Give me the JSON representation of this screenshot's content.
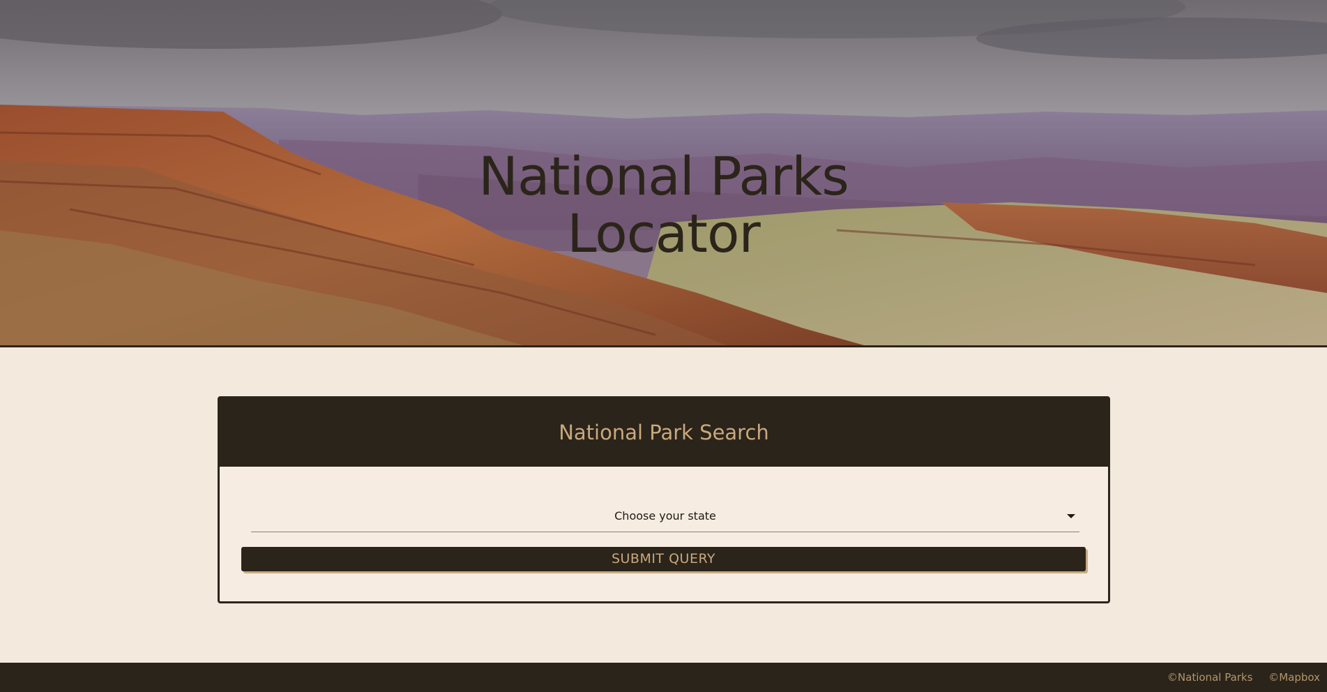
{
  "hero": {
    "title_line1": "National Parks",
    "title_line2": "Locator"
  },
  "search_card": {
    "heading": "National Park Search",
    "state_select": {
      "selected": "Choose your state"
    },
    "submit_label": "SUBMIT QUERY"
  },
  "footer": {
    "links": [
      "©National Parks",
      "©Mapbox"
    ]
  },
  "colors": {
    "dark_brown": "#2b241a",
    "tan_accent": "#c9a97e",
    "page_background": "#f3e9dd"
  },
  "icons": {
    "select_caret": "caret-down-icon"
  }
}
